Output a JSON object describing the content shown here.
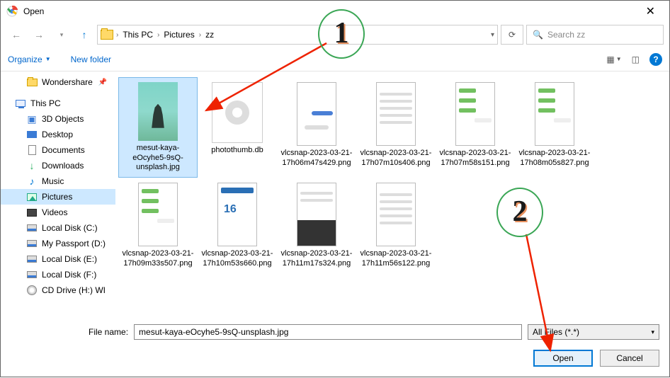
{
  "window": {
    "title": "Open"
  },
  "nav": {
    "crumbs": [
      "This PC",
      "Pictures",
      "zz"
    ],
    "search_placeholder": "Search zz"
  },
  "toolbar": {
    "organize": "Organize",
    "new_folder": "New folder"
  },
  "sidebar": {
    "items": [
      {
        "label": "Wondershare",
        "icon": "folder",
        "pinned": true
      },
      {
        "label": "This PC",
        "icon": "pc"
      },
      {
        "label": "3D Objects",
        "icon": "3d"
      },
      {
        "label": "Desktop",
        "icon": "desktop"
      },
      {
        "label": "Documents",
        "icon": "doc"
      },
      {
        "label": "Downloads",
        "icon": "down"
      },
      {
        "label": "Music",
        "icon": "music"
      },
      {
        "label": "Pictures",
        "icon": "pic",
        "selected": true
      },
      {
        "label": "Videos",
        "icon": "vid"
      },
      {
        "label": "Local Disk (C:)",
        "icon": "disk"
      },
      {
        "label": "My Passport (D:)",
        "icon": "disk"
      },
      {
        "label": "Local Disk (E:)",
        "icon": "disk"
      },
      {
        "label": "Local Disk (F:)",
        "icon": "disk"
      },
      {
        "label": "CD Drive (H:) WI",
        "icon": "cd"
      }
    ]
  },
  "files": [
    {
      "label": "mesut-kaya-eOcyhe5-9sQ-unsplash.jpg",
      "thumb": "img1",
      "selected": true
    },
    {
      "label": "photothumb.db",
      "thumb": "db"
    },
    {
      "label": "vlcsnap-2023-03-21-17h06m47s429.png",
      "thumb": "blue"
    },
    {
      "label": "vlcsnap-2023-03-21-17h07m10s406.png",
      "thumb": "form"
    },
    {
      "label": "vlcsnap-2023-03-21-17h07m58s151.png",
      "thumb": "chat"
    },
    {
      "label": "vlcsnap-2023-03-21-17h08m05s827.png",
      "thumb": "chat"
    },
    {
      "label": "vlcsnap-2023-03-21-17h09m33s507.png",
      "thumb": "chat"
    },
    {
      "label": "vlcsnap-2023-03-21-17h10m53s660.png",
      "thumb": "cal"
    },
    {
      "label": "vlcsnap-2023-03-21-17h11m17s324.png",
      "thumb": "kb"
    },
    {
      "label": "vlcsnap-2023-03-21-17h11m56s122.png",
      "thumb": "form"
    }
  ],
  "footer": {
    "filename_label": "File name:",
    "filename_value": "mesut-kaya-eOcyhe5-9sQ-unsplash.jpg",
    "filter": "All Files (*.*)",
    "open": "Open",
    "cancel": "Cancel"
  },
  "annotations": {
    "one": "1",
    "two": "2"
  }
}
